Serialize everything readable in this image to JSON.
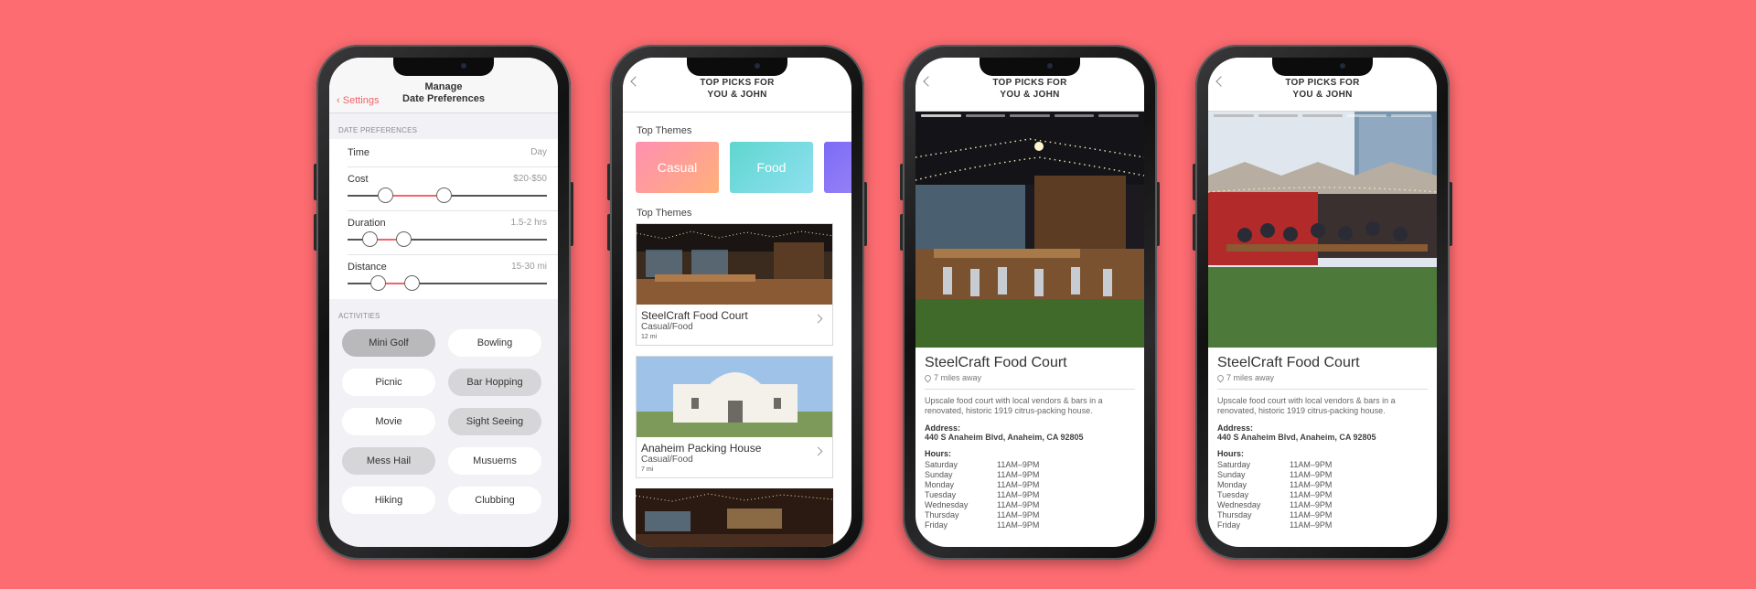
{
  "screen1": {
    "back_label": "Settings",
    "title_line1": "Manage",
    "title_line2": "Date Preferences",
    "section_prefs": "DATE PREFERENCES",
    "time": {
      "label": "Time",
      "value": "Day"
    },
    "cost": {
      "label": "Cost",
      "value": "$20-$50",
      "range": [
        0.19,
        0.48
      ]
    },
    "duration": {
      "label": "Duration",
      "value": "1.5-2 hrs",
      "range": [
        0.11,
        0.28
      ]
    },
    "distance": {
      "label": "Distance",
      "value": "15-30 mi",
      "range": [
        0.15,
        0.32
      ]
    },
    "section_activities": "ACTIVITIES",
    "activities": [
      {
        "label": "Mini Golf",
        "selected": true
      },
      {
        "label": "Bowling",
        "selected": false
      },
      {
        "label": "Picnic",
        "selected": false
      },
      {
        "label": "Bar Hopping",
        "selected": true
      },
      {
        "label": "Movie",
        "selected": false
      },
      {
        "label": "Sight Seeing",
        "selected": true
      },
      {
        "label": "Mess Hail",
        "selected": true
      },
      {
        "label": "Musuems",
        "selected": false
      },
      {
        "label": "Hiking",
        "selected": false
      },
      {
        "label": "Clubbing",
        "selected": false
      }
    ]
  },
  "screen2": {
    "title_line1": "TOP PICKS FOR",
    "title_line2": "YOU & JOHN",
    "themes_label": "Top Themes",
    "themes": [
      {
        "label": "Casual",
        "from": "#ff8fb1",
        "to": "#ffb07a"
      },
      {
        "label": "Food",
        "from": "#5fd6cf",
        "to": "#8fe0f0"
      },
      {
        "label": "",
        "from": "#7b6cf6",
        "to": "#a98cf5"
      }
    ],
    "picks_label": "Top Themes",
    "cards": [
      {
        "name": "SteelCraft Food Court",
        "category": "Casual/Food",
        "distance": "12 mi"
      },
      {
        "name": "Anaheim Packing House",
        "category": "Casual/Food",
        "distance": "7 mi"
      }
    ]
  },
  "detail": {
    "title_line1": "TOP PICKS FOR",
    "title_line2": "YOU & JOHN",
    "name": "SteelCraft Food Court",
    "miles": "7 miles away",
    "description": "Upscale food court with local vendors & bars in a renovated, historic 1919 citrus-packing house.",
    "address_label": "Address:",
    "address": "440 S Anaheim Blvd, Anaheim, CA 92805",
    "hours_label": "Hours:",
    "hours": [
      {
        "day": "Saturday",
        "time": "11AM–9PM"
      },
      {
        "day": "Sunday",
        "time": "11AM–9PM"
      },
      {
        "day": "Monday",
        "time": "11AM–9PM"
      },
      {
        "day": "Tuesday",
        "time": "11AM–9PM"
      },
      {
        "day": "Wednesday",
        "time": "11AM–9PM"
      },
      {
        "day": "Thursday",
        "time": "11AM–9PM"
      },
      {
        "day": "Friday",
        "time": "11AM–9PM"
      }
    ]
  }
}
